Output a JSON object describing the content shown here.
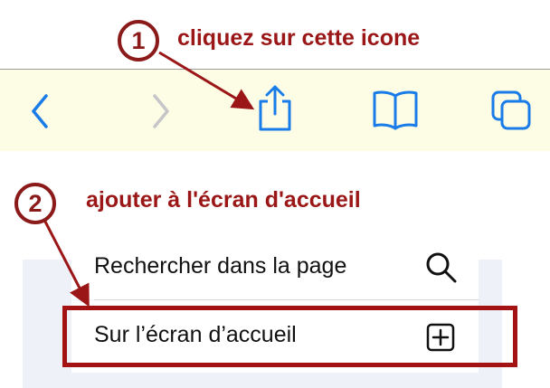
{
  "colors": {
    "toolbar_bg": "#fdfce4",
    "ios_blue": "#1a7ce8",
    "annotation_red": "#9b1616",
    "disabled_gray": "#c6c6c8"
  },
  "annotations": {
    "step1": {
      "number": "1",
      "text": "cliquez sur cette icone"
    },
    "step2": {
      "number": "2",
      "text": "ajouter à l'écran d'accueil"
    }
  },
  "toolbar": {
    "items": [
      {
        "name": "back",
        "icon": "chevron-left-icon",
        "enabled": true
      },
      {
        "name": "forward",
        "icon": "chevron-right-icon",
        "enabled": false
      },
      {
        "name": "share",
        "icon": "share-icon",
        "enabled": true
      },
      {
        "name": "bookmarks",
        "icon": "book-icon",
        "enabled": true
      },
      {
        "name": "tabs",
        "icon": "tabs-icon",
        "enabled": true
      }
    ]
  },
  "share_sheet": {
    "items": [
      {
        "label": "Rechercher dans la page",
        "icon": "search-icon"
      },
      {
        "label": "Sur l’écran d’accueil",
        "icon": "plus-square-icon"
      }
    ]
  }
}
